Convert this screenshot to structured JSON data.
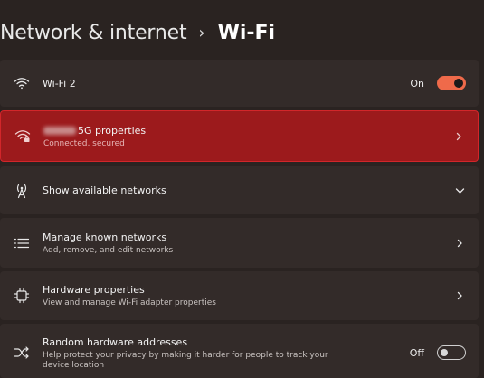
{
  "header": {
    "parent": "Network & internet",
    "separator": "›",
    "current": "Wi-Fi"
  },
  "rows": {
    "wifi": {
      "label": "Wi-Fi 2",
      "toggle_label": "On",
      "toggle_state": "on",
      "icon": "wifi-icon"
    },
    "properties": {
      "title_suffix": "5G properties",
      "subtitle": "Connected, secured",
      "icon": "wifi-secured-icon"
    },
    "available": {
      "label": "Show available networks",
      "icon": "antenna-icon"
    },
    "known": {
      "label": "Manage known networks",
      "subtitle": "Add, remove, and edit networks",
      "icon": "list-icon"
    },
    "hardware": {
      "label": "Hardware properties",
      "subtitle": "View and manage Wi-Fi adapter properties",
      "icon": "chip-icon"
    },
    "random": {
      "label": "Random hardware addresses",
      "subtitle": "Help protect your privacy by making it harder for people to track your",
      "subtitle2": "device location",
      "toggle_label": "Off",
      "toggle_state": "off",
      "icon": "shuffle-icon"
    }
  },
  "colors": {
    "accent": "#ef6a4a",
    "highlight": "#9c1a1c",
    "card": "#332b29",
    "background": "#2a2321"
  }
}
